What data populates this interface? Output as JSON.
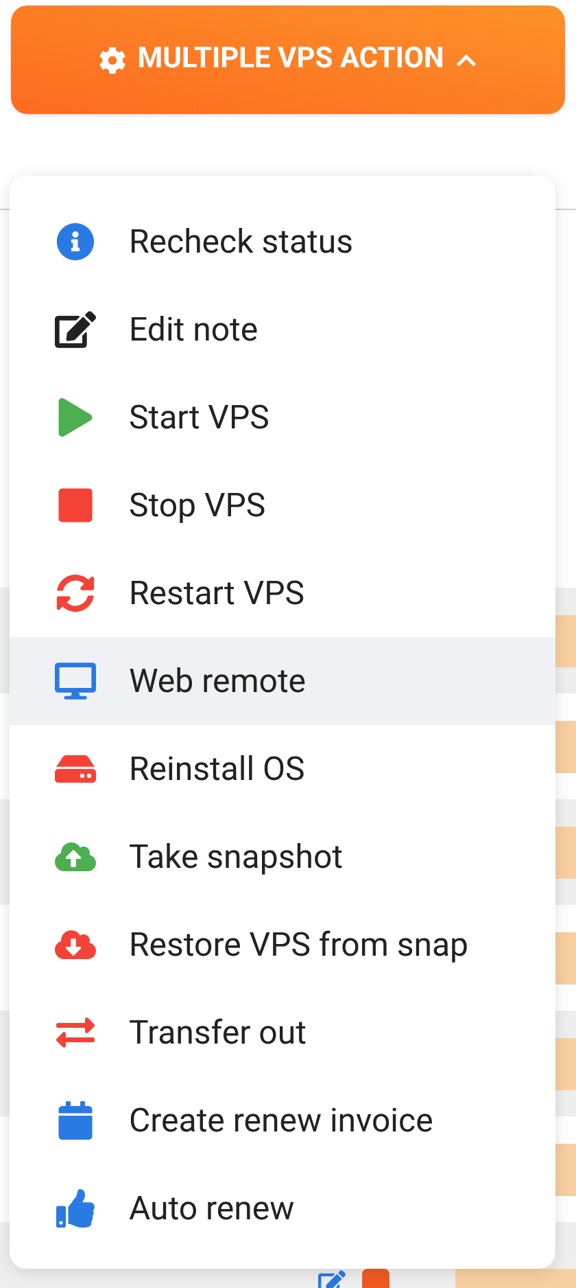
{
  "action_button": {
    "label": "MULTIPLE VPS ACTION",
    "expanded": true
  },
  "menu": {
    "items": [
      {
        "kind": "info",
        "label": "Recheck status",
        "highlighted": false
      },
      {
        "kind": "edit",
        "label": "Edit note",
        "highlighted": false
      },
      {
        "kind": "start",
        "label": "Start VPS",
        "highlighted": false
      },
      {
        "kind": "stop",
        "label": "Stop VPS",
        "highlighted": false
      },
      {
        "kind": "restart",
        "label": "Restart VPS",
        "highlighted": false
      },
      {
        "kind": "remote",
        "label": "Web remote",
        "highlighted": true
      },
      {
        "kind": "reinstall",
        "label": "Reinstall OS",
        "highlighted": false
      },
      {
        "kind": "snapshot",
        "label": "Take snapshot",
        "highlighted": false
      },
      {
        "kind": "restore",
        "label": "Restore VPS from snap",
        "highlighted": false
      },
      {
        "kind": "transfer",
        "label": "Transfer out",
        "highlighted": false
      },
      {
        "kind": "invoice",
        "label": "Create renew invoice",
        "highlighted": false
      },
      {
        "kind": "autorenew",
        "label": "Auto renew",
        "highlighted": false
      }
    ]
  },
  "table": {
    "rows": [
      {
        "badge": true
      },
      {
        "badge": true
      },
      {
        "badge": true
      },
      {
        "badge": true
      },
      {
        "badge": true
      },
      {
        "badge": true
      },
      {
        "badge": true,
        "actions": true
      }
    ]
  }
}
